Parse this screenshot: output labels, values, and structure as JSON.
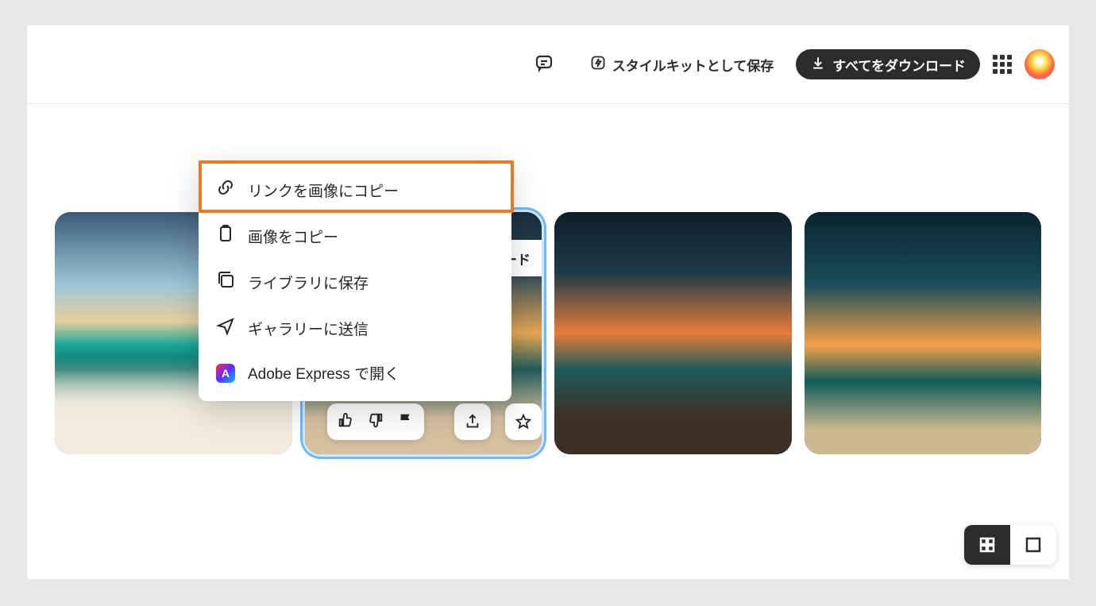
{
  "topbar": {
    "stylekit_label": "スタイルキットとして保存",
    "download_label": "すべてをダウンロード"
  },
  "context_menu": {
    "items": [
      {
        "id": "copy-link",
        "label": "リンクを画像にコピー"
      },
      {
        "id": "copy-image",
        "label": "画像をコピー"
      },
      {
        "id": "save-library",
        "label": "ライブラリに保存"
      },
      {
        "id": "send-gallery",
        "label": "ギャラリーに送信"
      },
      {
        "id": "open-express",
        "label": "Adobe Express で開く"
      }
    ],
    "highlighted_index": 0
  },
  "tiles": {
    "active_index": 1,
    "code_chip_label": "ード"
  },
  "view_toggle": {
    "active": "grid"
  }
}
